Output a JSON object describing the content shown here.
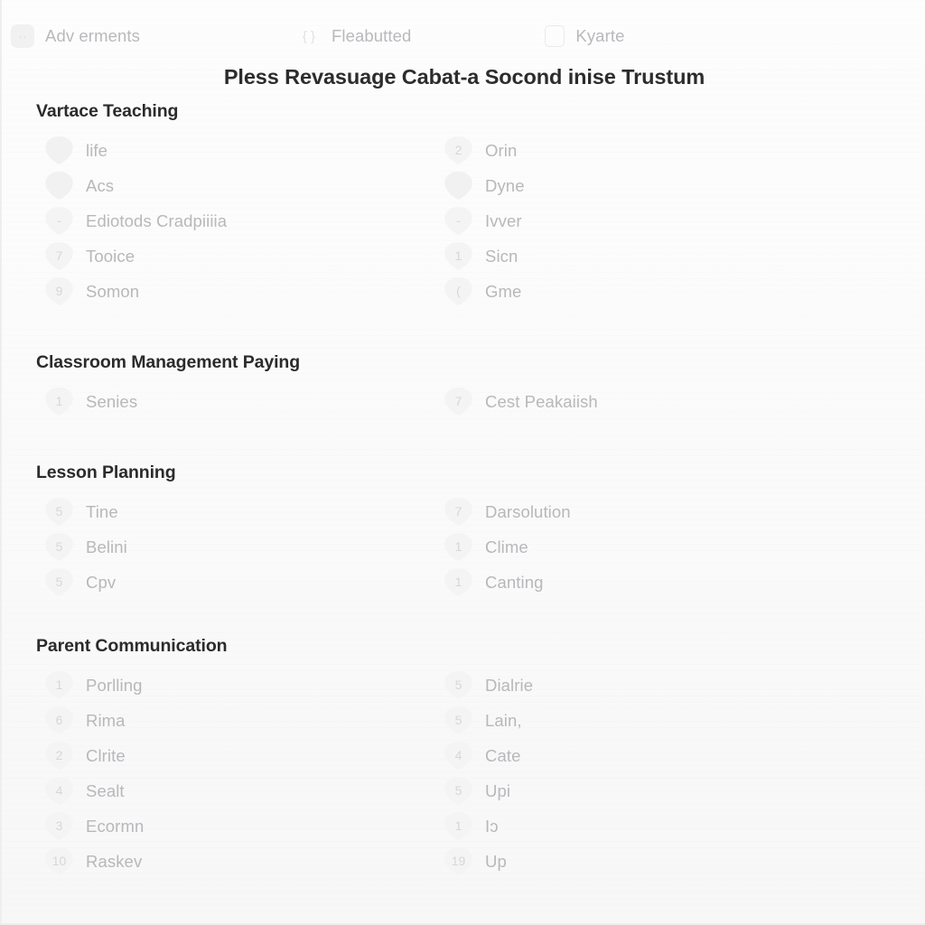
{
  "topbar": {
    "chips": [
      {
        "label": "Adv erments",
        "icon": "square-dots-icon",
        "icon_glyph": "··",
        "style": "tile"
      },
      {
        "label": "Fleabutted",
        "icon": "braces-icon",
        "icon_glyph": "{ }",
        "style": "plain"
      },
      {
        "label": "Kyarte",
        "icon": "window-icon",
        "icon_glyph": "",
        "style": "box"
      }
    ]
  },
  "title": "Pless Revasuage Cabat-a Socond inise Trustum",
  "sections": [
    {
      "heading": "Vartace Teaching",
      "left": [
        {
          "count": "",
          "label": "life"
        },
        {
          "count": "",
          "label": "Acs"
        },
        {
          "count": "-",
          "label": "Ediotods Cradpiiiia"
        },
        {
          "count": "7",
          "label": "Tooice"
        },
        {
          "count": "9",
          "label": "Somon"
        }
      ],
      "right": [
        {
          "count": "2",
          "label": "Orin"
        },
        {
          "count": "",
          "label": "Dyne"
        },
        {
          "count": "-",
          "label": "Ivver"
        },
        {
          "count": "1",
          "label": "Sicn"
        },
        {
          "count": "(",
          "label": "Gme"
        }
      ]
    },
    {
      "heading": "Classroom Management Paying",
      "left": [
        {
          "count": "1",
          "label": "Senies"
        }
      ],
      "right": [
        {
          "count": "7",
          "label": "Cest Peakaiish"
        }
      ]
    },
    {
      "heading": "Lesson Planning",
      "left": [
        {
          "count": "5",
          "label": "Tine"
        },
        {
          "count": "5",
          "label": "Belini"
        },
        {
          "count": "5",
          "label": "Cpv"
        }
      ],
      "right": [
        {
          "count": "7",
          "label": "Darsolution"
        },
        {
          "count": "1",
          "label": "Clime"
        },
        {
          "count": "1",
          "label": "Canting"
        }
      ]
    },
    {
      "heading": "Parent Communication",
      "left": [
        {
          "count": "1",
          "label": "Porlling"
        },
        {
          "count": "6",
          "label": "Rima"
        },
        {
          "count": "2",
          "label": "Clrite"
        },
        {
          "count": "4",
          "label": "Sealt"
        },
        {
          "count": "3",
          "label": "Ecormn"
        },
        {
          "count": "10",
          "label": "Raskev"
        }
      ],
      "right": [
        {
          "count": "5",
          "label": "Dialrie"
        },
        {
          "count": "5",
          "label": "Lain,"
        },
        {
          "count": "4",
          "label": "Cate"
        },
        {
          "count": "5",
          "label": "Upi"
        },
        {
          "count": "1",
          "label": "Iɔ"
        },
        {
          "count": "19",
          "label": "Up"
        }
      ]
    }
  ],
  "colors": {
    "page_bg": "#fbfbfb",
    "title_text": "#2c2c2e",
    "heading_text": "#2b2b2d",
    "muted_text": "#b8b8bc",
    "badge_bg": "#f4f4f5",
    "badge_text": "#d7d7da"
  }
}
